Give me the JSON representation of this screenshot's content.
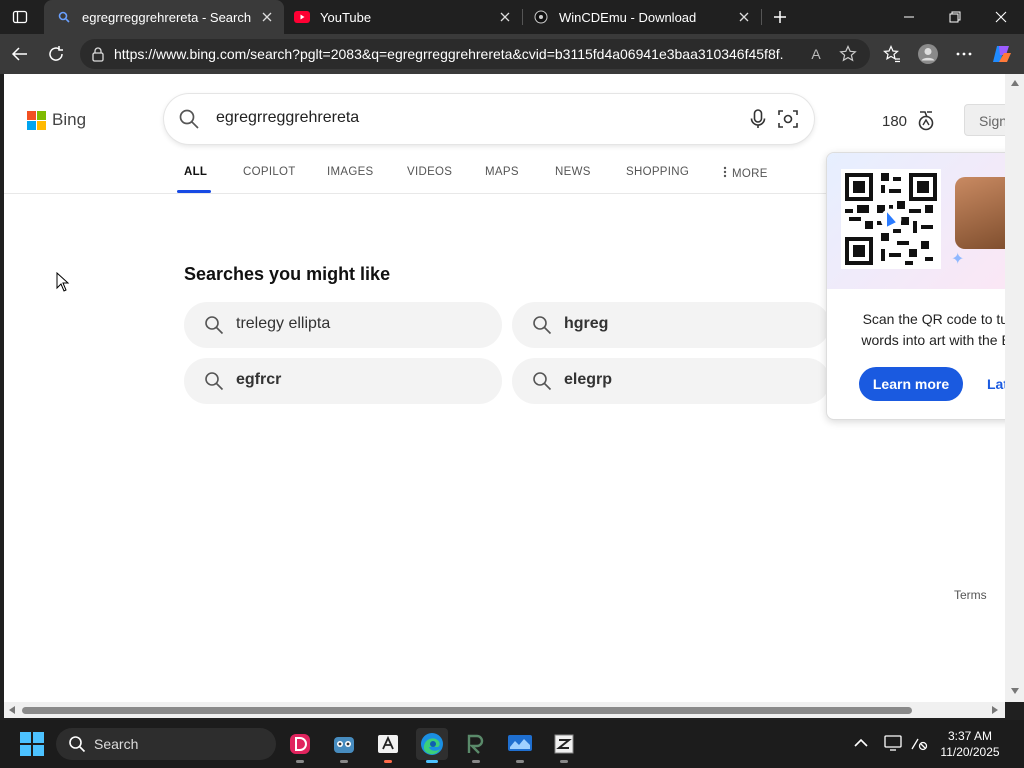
{
  "browser": {
    "tabs": [
      {
        "title": "egregrreggrehrereta - Search",
        "active": true,
        "icon": "bing-search-icon"
      },
      {
        "title": "YouTube",
        "active": false,
        "icon": "youtube-icon"
      },
      {
        "title": "WinCDEmu - Download",
        "active": false,
        "icon": "wincdemu-icon"
      }
    ],
    "address": {
      "url": "https://www.bing.com/search?pglt=2083&q=egregrreggrehrereta&cvid=b3115fd4a06941e3baa310346f45f8f..."
    },
    "read_aloud_label": "A"
  },
  "page": {
    "logo_text": "Bing",
    "query": "egregrreggrehrereta",
    "rewards_points": "180",
    "signin_label": "Sign",
    "scopes": {
      "all": "ALL",
      "copilot": "COPILOT",
      "images": "IMAGES",
      "videos": "VIDEOS",
      "maps": "MAPS",
      "news": "NEWS",
      "shopping": "SHOPPING",
      "more": "MORE"
    },
    "might_like": {
      "title": "Searches you might like",
      "items": [
        {
          "text": "trelegy ellipta",
          "bold": false
        },
        {
          "text": "hgreg",
          "bold": true
        },
        {
          "text": "egfrcr",
          "bold": true
        },
        {
          "text": "elegrp",
          "bold": true
        }
      ]
    },
    "qr_promo": {
      "line1": "Scan the QR code to turr",
      "line2": "words into art with the Bir",
      "learn_more": "Learn more",
      "later": "Lat"
    },
    "terms": "Terms"
  },
  "taskbar": {
    "search_label": "Search",
    "time": "3:37 AM",
    "date": "11/20/2025"
  },
  "colors": {
    "accent": "#174ae4",
    "learn_more_bg": "#1a5ae0",
    "chip_bg": "#f3f3f3",
    "windows_blue": "#4cc2ff"
  }
}
